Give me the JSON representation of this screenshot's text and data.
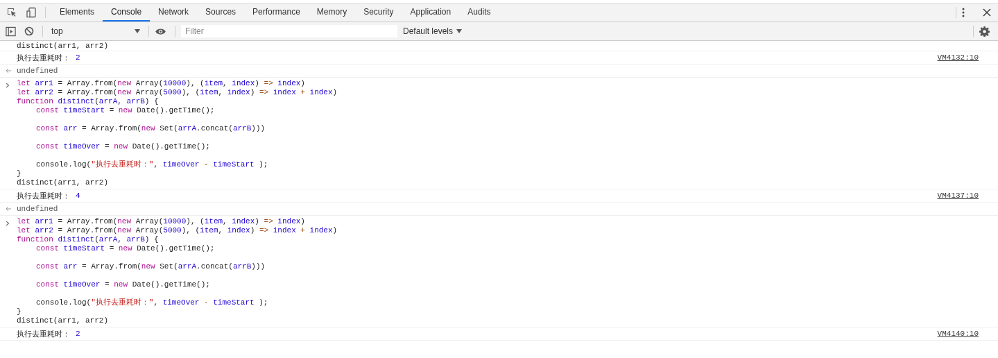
{
  "tabs": [
    {
      "label": "Elements",
      "selected": false
    },
    {
      "label": "Console",
      "selected": true
    },
    {
      "label": "Network",
      "selected": false
    },
    {
      "label": "Sources",
      "selected": false
    },
    {
      "label": "Performance",
      "selected": false
    },
    {
      "label": "Memory",
      "selected": false
    },
    {
      "label": "Security",
      "selected": false
    },
    {
      "label": "Application",
      "selected": false
    },
    {
      "label": "Audits",
      "selected": false
    }
  ],
  "toolbar": {
    "context": "top",
    "filter": {
      "placeholder": "Filter"
    },
    "levels": "Default levels"
  },
  "console": [
    {
      "kind": "cut",
      "text": "distinct(arr1, arr2)"
    },
    {
      "kind": "log",
      "text": "执行去重耗时：",
      "value": "2",
      "source": "VM4132:10"
    },
    {
      "kind": "result",
      "text": "undefined"
    },
    {
      "kind": "input",
      "lines": [
        {
          "gap": false,
          "indent": false,
          "tokens": [
            {
              "kind": "kw",
              "text": "let"
            },
            {
              "kind": "var",
              "text": " arr1"
            },
            {
              "kind": "plain",
              "text": " = Array.from("
            },
            {
              "kind": "kw",
              "text": "new"
            },
            {
              "kind": "plain",
              "text": " Array("
            },
            {
              "kind": "num",
              "text": "10000"
            },
            {
              "kind": "plain",
              "text": "), ("
            },
            {
              "kind": "var",
              "text": "item"
            },
            {
              "kind": "plain",
              "text": ", "
            },
            {
              "kind": "var",
              "text": "index"
            },
            {
              "kind": "plain",
              "text": ") "
            },
            {
              "kind": "op",
              "text": "=>"
            },
            {
              "kind": "var",
              "text": " index"
            },
            {
              "kind": "plain",
              "text": ")"
            }
          ]
        },
        {
          "gap": false,
          "indent": false,
          "tokens": [
            {
              "kind": "kw",
              "text": "let"
            },
            {
              "kind": "var",
              "text": " arr2"
            },
            {
              "kind": "plain",
              "text": " = Array.from("
            },
            {
              "kind": "kw",
              "text": "new"
            },
            {
              "kind": "plain",
              "text": " Array("
            },
            {
              "kind": "num",
              "text": "5000"
            },
            {
              "kind": "plain",
              "text": "), ("
            },
            {
              "kind": "var",
              "text": "item"
            },
            {
              "kind": "plain",
              "text": ", "
            },
            {
              "kind": "var",
              "text": "index"
            },
            {
              "kind": "plain",
              "text": ") "
            },
            {
              "kind": "op",
              "text": "=>"
            },
            {
              "kind": "var",
              "text": " index"
            },
            {
              "kind": "op",
              "text": " +"
            },
            {
              "kind": "var",
              "text": " index"
            },
            {
              "kind": "plain",
              "text": ")"
            }
          ]
        },
        {
          "gap": false,
          "indent": false,
          "tokens": [
            {
              "kind": "kw",
              "text": "function"
            },
            {
              "kind": "var",
              "text": " distinct"
            },
            {
              "kind": "plain",
              "text": "("
            },
            {
              "kind": "var",
              "text": "arrA"
            },
            {
              "kind": "plain",
              "text": ", "
            },
            {
              "kind": "var",
              "text": "arrB"
            },
            {
              "kind": "plain",
              "text": ") {"
            }
          ]
        },
        {
          "gap": false,
          "indent": true,
          "tokens": [
            {
              "kind": "kw",
              "text": "const"
            },
            {
              "kind": "var",
              "text": " timeStart"
            },
            {
              "kind": "plain",
              "text": " = "
            },
            {
              "kind": "kw",
              "text": "new"
            },
            {
              "kind": "plain",
              "text": " Date().getTime();"
            }
          ]
        },
        {
          "gap": true,
          "indent": true,
          "tokens": [
            {
              "kind": "kw",
              "text": "const"
            },
            {
              "kind": "var",
              "text": " arr"
            },
            {
              "kind": "plain",
              "text": " = Array.from("
            },
            {
              "kind": "kw",
              "text": "new"
            },
            {
              "kind": "plain",
              "text": " Set("
            },
            {
              "kind": "var",
              "text": "arrA"
            },
            {
              "kind": "plain",
              "text": ".concat("
            },
            {
              "kind": "var",
              "text": "arrB"
            },
            {
              "kind": "plain",
              "text": ")))"
            }
          ]
        },
        {
          "gap": true,
          "indent": true,
          "tokens": [
            {
              "kind": "kw",
              "text": "const"
            },
            {
              "kind": "var",
              "text": " timeOver"
            },
            {
              "kind": "plain",
              "text": " = "
            },
            {
              "kind": "kw",
              "text": "new"
            },
            {
              "kind": "plain",
              "text": " Date().getTime();"
            }
          ]
        },
        {
          "gap": true,
          "indent": true,
          "tokens": [
            {
              "kind": "plain",
              "text": "console.log("
            },
            {
              "kind": "str",
              "text": "\"执行去重耗时：\""
            },
            {
              "kind": "plain",
              "text": ", "
            },
            {
              "kind": "var",
              "text": "timeOver"
            },
            {
              "kind": "op",
              "text": " -"
            },
            {
              "kind": "var",
              "text": " timeStart"
            },
            {
              "kind": "plain",
              "text": " );"
            }
          ]
        },
        {
          "gap": false,
          "indent": false,
          "tokens": [
            {
              "kind": "plain",
              "text": "}"
            }
          ]
        },
        {
          "gap": false,
          "indent": false,
          "tokens": [
            {
              "kind": "plain",
              "text": "distinct(arr1, arr2)"
            }
          ]
        }
      ]
    },
    {
      "kind": "log",
      "text": "执行去重耗时：",
      "value": "4",
      "source": "VM4137:10"
    },
    {
      "kind": "result",
      "text": "undefined"
    },
    {
      "kind": "input",
      "lines": [
        {
          "gap": false,
          "indent": false,
          "tokens": [
            {
              "kind": "kw",
              "text": "let"
            },
            {
              "kind": "var",
              "text": " arr1"
            },
            {
              "kind": "plain",
              "text": " = Array.from("
            },
            {
              "kind": "kw",
              "text": "new"
            },
            {
              "kind": "plain",
              "text": " Array("
            },
            {
              "kind": "num",
              "text": "10000"
            },
            {
              "kind": "plain",
              "text": "), ("
            },
            {
              "kind": "var",
              "text": "item"
            },
            {
              "kind": "plain",
              "text": ", "
            },
            {
              "kind": "var",
              "text": "index"
            },
            {
              "kind": "plain",
              "text": ") "
            },
            {
              "kind": "op",
              "text": "=>"
            },
            {
              "kind": "var",
              "text": " index"
            },
            {
              "kind": "plain",
              "text": ")"
            }
          ]
        },
        {
          "gap": false,
          "indent": false,
          "tokens": [
            {
              "kind": "kw",
              "text": "let"
            },
            {
              "kind": "var",
              "text": " arr2"
            },
            {
              "kind": "plain",
              "text": " = Array.from("
            },
            {
              "kind": "kw",
              "text": "new"
            },
            {
              "kind": "plain",
              "text": " Array("
            },
            {
              "kind": "num",
              "text": "5000"
            },
            {
              "kind": "plain",
              "text": "), ("
            },
            {
              "kind": "var",
              "text": "item"
            },
            {
              "kind": "plain",
              "text": ", "
            },
            {
              "kind": "var",
              "text": "index"
            },
            {
              "kind": "plain",
              "text": ") "
            },
            {
              "kind": "op",
              "text": "=>"
            },
            {
              "kind": "var",
              "text": " index"
            },
            {
              "kind": "op",
              "text": " +"
            },
            {
              "kind": "var",
              "text": " index"
            },
            {
              "kind": "plain",
              "text": ")"
            }
          ]
        },
        {
          "gap": false,
          "indent": false,
          "tokens": [
            {
              "kind": "kw",
              "text": "function"
            },
            {
              "kind": "var",
              "text": " distinct"
            },
            {
              "kind": "plain",
              "text": "("
            },
            {
              "kind": "var",
              "text": "arrA"
            },
            {
              "kind": "plain",
              "text": ", "
            },
            {
              "kind": "var",
              "text": "arrB"
            },
            {
              "kind": "plain",
              "text": ") {"
            }
          ]
        },
        {
          "gap": false,
          "indent": true,
          "tokens": [
            {
              "kind": "kw",
              "text": "const"
            },
            {
              "kind": "var",
              "text": " timeStart"
            },
            {
              "kind": "plain",
              "text": " = "
            },
            {
              "kind": "kw",
              "text": "new"
            },
            {
              "kind": "plain",
              "text": " Date().getTime();"
            }
          ]
        },
        {
          "gap": true,
          "indent": true,
          "tokens": [
            {
              "kind": "kw",
              "text": "const"
            },
            {
              "kind": "var",
              "text": " arr"
            },
            {
              "kind": "plain",
              "text": " = Array.from("
            },
            {
              "kind": "kw",
              "text": "new"
            },
            {
              "kind": "plain",
              "text": " Set("
            },
            {
              "kind": "var",
              "text": "arrA"
            },
            {
              "kind": "plain",
              "text": ".concat("
            },
            {
              "kind": "var",
              "text": "arrB"
            },
            {
              "kind": "plain",
              "text": ")))"
            }
          ]
        },
        {
          "gap": true,
          "indent": true,
          "tokens": [
            {
              "kind": "kw",
              "text": "const"
            },
            {
              "kind": "var",
              "text": " timeOver"
            },
            {
              "kind": "plain",
              "text": " = "
            },
            {
              "kind": "kw",
              "text": "new"
            },
            {
              "kind": "plain",
              "text": " Date().getTime();"
            }
          ]
        },
        {
          "gap": true,
          "indent": true,
          "tokens": [
            {
              "kind": "plain",
              "text": "console.log("
            },
            {
              "kind": "str",
              "text": "\"执行去重耗时：\""
            },
            {
              "kind": "plain",
              "text": ", "
            },
            {
              "kind": "var",
              "text": "timeOver"
            },
            {
              "kind": "op",
              "text": " -"
            },
            {
              "kind": "var",
              "text": " timeStart"
            },
            {
              "kind": "plain",
              "text": " );"
            }
          ]
        },
        {
          "gap": false,
          "indent": false,
          "tokens": [
            {
              "kind": "plain",
              "text": "}"
            }
          ]
        },
        {
          "gap": false,
          "indent": false,
          "tokens": [
            {
              "kind": "plain",
              "text": "distinct(arr1, arr2)"
            }
          ]
        }
      ]
    },
    {
      "kind": "log",
      "text": "执行去重耗时：",
      "value": "2",
      "source": "VM4140:10"
    }
  ]
}
